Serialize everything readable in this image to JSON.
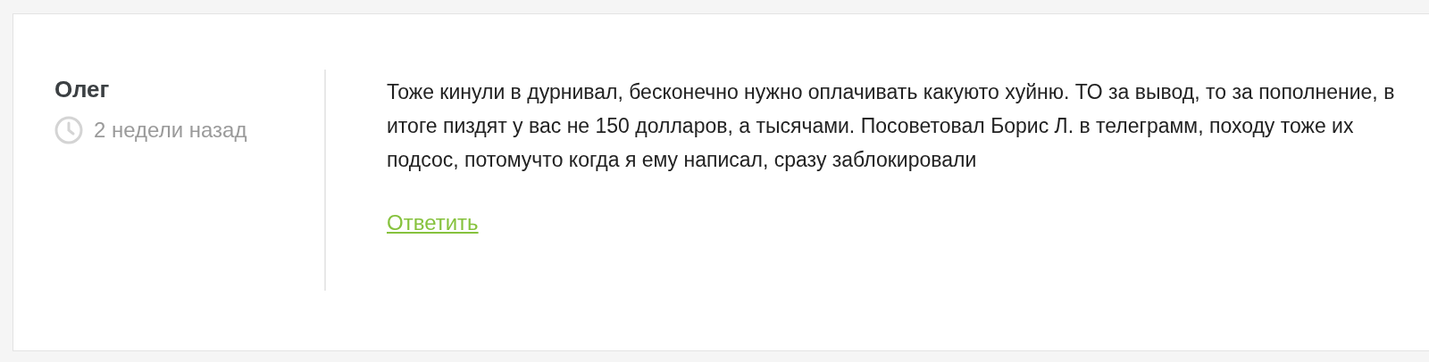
{
  "comment": {
    "author": "Олег",
    "time": "2 недели назад",
    "text": "Тоже кинули в дурнивал, бесконечно нужно оплачивать какуюто хуйню. ТО за вывод, то за пополнение, в итоге пиздят у вас не 150 долларов, а тысячами. Посоветовал Борис Л. в телеграмм, походу тоже их подсос, потомучто когда я ему написал, сразу заблокировали",
    "reply": "Ответить"
  }
}
